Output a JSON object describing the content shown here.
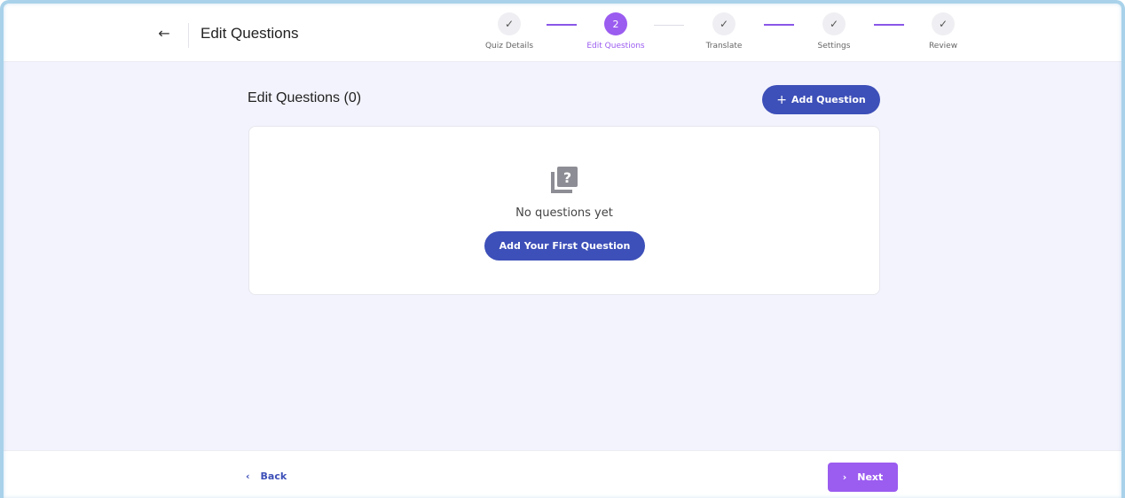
{
  "header": {
    "title": "Edit Questions",
    "back_icon": "arrow-left-icon",
    "steps": [
      {
        "label": "Quiz Details",
        "state": "done",
        "mark": "✓"
      },
      {
        "label": "Edit Questions",
        "state": "active",
        "mark": "2"
      },
      {
        "label": "Translate",
        "state": "done",
        "mark": "✓"
      },
      {
        "label": "Settings",
        "state": "done",
        "mark": "✓"
      },
      {
        "label": "Review",
        "state": "done",
        "mark": "✓"
      }
    ]
  },
  "main": {
    "section_title": "Edit Questions (0)",
    "add_question_label": "Add Question",
    "add_question_icon": "plus-icon",
    "empty_state": {
      "icon": "question-stack-icon",
      "message": "No questions yet",
      "cta_label": "Add Your First Question"
    }
  },
  "footer": {
    "back_label": "Back",
    "next_label": "Next"
  },
  "colors": {
    "primary": "#3d4fb8",
    "accent": "#9b5cf0",
    "background": "#f3f3fd"
  }
}
